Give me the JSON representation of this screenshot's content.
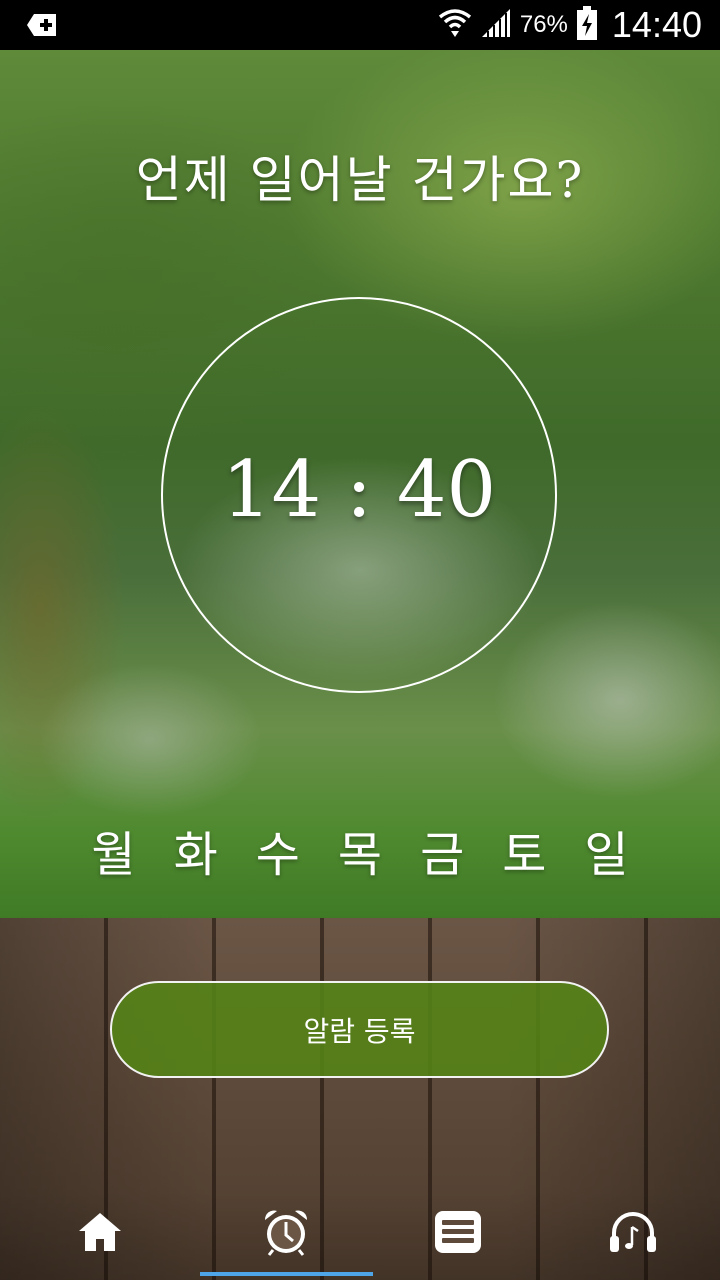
{
  "status_bar": {
    "battery_percent": "76%",
    "time": "14:40",
    "icons": [
      "notification-icon",
      "wifi-icon",
      "signal-icon",
      "battery-charging-icon"
    ]
  },
  "main": {
    "headline": "언제 일어날 건가요?",
    "alarm_time": "14 : 40",
    "weekdays": [
      "월",
      "화",
      "수",
      "목",
      "금",
      "토",
      "일"
    ]
  },
  "register_button": {
    "label": "알람 등록"
  },
  "bottom_nav": {
    "items": [
      {
        "icon": "home-icon"
      },
      {
        "icon": "alarm-clock-icon",
        "selected": true
      },
      {
        "icon": "list-icon"
      },
      {
        "icon": "headphones-music-icon"
      }
    ]
  },
  "colors": {
    "button_fill": "#548416",
    "nav_indicator": "#4ea5e8"
  }
}
